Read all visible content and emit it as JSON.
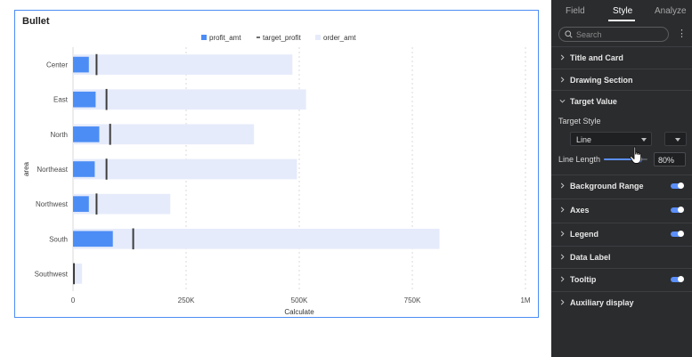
{
  "chart": {
    "title": "Bullet",
    "legend": [
      {
        "name": "profit_amt",
        "color": "#4c8df5",
        "marker": "square"
      },
      {
        "name": "target_profit",
        "color": "#3d3d3d",
        "marker": "line"
      },
      {
        "name": "order_amt",
        "color": "#e6ebfb",
        "marker": "square"
      }
    ],
    "xlabel": "Calculate",
    "ylabel": "area"
  },
  "chart_data": {
    "type": "bar",
    "subtype": "bullet",
    "orientation": "horizontal",
    "categories": [
      "Center",
      "East",
      "North",
      "Northeast",
      "Northwest",
      "South",
      "Southwest"
    ],
    "series": [
      {
        "name": "profit_amt",
        "values": [
          35000,
          50000,
          58000,
          48000,
          35000,
          88000,
          2000
        ]
      },
      {
        "name": "target_profit",
        "values": [
          52000,
          74000,
          82000,
          74000,
          52000,
          133000,
          2000
        ]
      },
      {
        "name": "order_amt",
        "values": [
          485000,
          515000,
          400000,
          495000,
          215000,
          810000,
          20000
        ]
      }
    ],
    "xlabel": "Calculate",
    "ylabel": "area",
    "xlim": [
      0,
      1000000
    ],
    "xticks": [
      {
        "value": 0,
        "label": "0"
      },
      {
        "value": 250000,
        "label": "250K"
      },
      {
        "value": 500000,
        "label": "500K"
      },
      {
        "value": 750000,
        "label": "750K"
      },
      {
        "value": 1000000,
        "label": "1M"
      }
    ],
    "grid": true,
    "legend_position": "top-center",
    "colors": {
      "profit": "#4c8df5",
      "target": "#3d3d3d",
      "background": "#e6ebfb"
    }
  },
  "panel": {
    "tabs": [
      {
        "label": "Field",
        "active": false
      },
      {
        "label": "Style",
        "active": true
      },
      {
        "label": "Analyze",
        "active": false
      }
    ],
    "search_placeholder": "Search",
    "more_icon": "more-vertical-icon",
    "sections": [
      {
        "label": "Title and Card",
        "expanded": false,
        "toggle": false
      },
      {
        "label": "Drawing Section",
        "expanded": false,
        "toggle": false
      },
      {
        "label": "Target Value",
        "expanded": true,
        "toggle": false
      },
      {
        "label": "Background Range",
        "expanded": false,
        "toggle": true
      },
      {
        "label": "Axes",
        "expanded": false,
        "toggle": true
      },
      {
        "label": "Legend",
        "expanded": false,
        "toggle": true
      },
      {
        "label": "Data Label",
        "expanded": false,
        "toggle": false
      },
      {
        "label": "Tooltip",
        "expanded": false,
        "toggle": true
      },
      {
        "label": "Auxiliary display",
        "expanded": false,
        "toggle": false
      }
    ],
    "target_value": {
      "target_style_label": "Target Style",
      "line_style": "Line",
      "line_length_label": "Line Length",
      "line_length_value": "80%",
      "line_length_fraction": 0.8
    },
    "accent_color": "#5b8ff9"
  }
}
